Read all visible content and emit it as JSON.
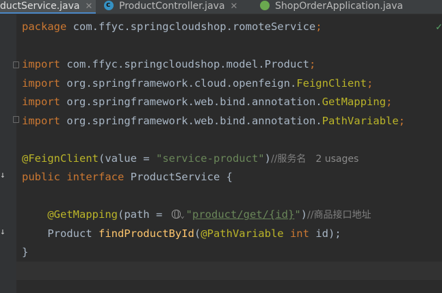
{
  "tabs": [
    {
      "label": "ductService.java",
      "close": "✕",
      "active": true
    },
    {
      "label": "ProductController.java",
      "close": "✕",
      "active": false
    },
    {
      "label": "ShopOrderApplication.java",
      "active": false
    }
  ],
  "code": {
    "l1_kw": "package",
    "l1_rest": " com.ffyc.springcloudshop.romoteService",
    "l1_semi": ";",
    "l3_kw": "import",
    "l3_rest": " com.ffyc.springcloudshop.model.Product",
    "l3_semi": ";",
    "l4_kw": "import",
    "l4_pkg": " org.springframework.cloud.openfeign.",
    "l4_cls": "FeignClient",
    "l4_semi": ";",
    "l5_kw": "import",
    "l5_pkg": " org.springframework.web.bind.annotation.",
    "l5_cls": "GetMapping",
    "l5_semi": ";",
    "l6_kw": "import",
    "l6_pkg": " org.springframework.web.bind.annotation.",
    "l6_cls": "PathVariable",
    "l6_semi": ";",
    "l8_ann": "@FeignClient",
    "l8_paren": "(value = ",
    "l8_str": "\"service-product\"",
    "l8_close": ")",
    "l8_cmt": "//服务名",
    "l8_usages": "2 usages",
    "l9_kw1": "public",
    "l9_kw2": "interface",
    "l9_name": " ProductService {",
    "l11_ann": "@GetMapping",
    "l11_paren": "(path = ",
    "l11_q1": "\"",
    "l11_link": "product/get/{id}",
    "l11_q2": "\"",
    "l11_close": ")",
    "l11_cmt": "//商品接口地址",
    "l12_type": "Product ",
    "l12_fn": "findProductById",
    "l12_open": "(",
    "l12_ann": "@PathVariable",
    "l12_kw": " int",
    "l12_rest": " id);",
    "l13": "}"
  },
  "gutter": {
    "impl_mark": "↓"
  },
  "status": {
    "check": "✓"
  },
  "colors": {
    "background": "#2b2b2b",
    "keyword": "#cc7832",
    "annotation": "#bbb529",
    "string": "#6a8759",
    "comment": "#808080",
    "method": "#ffc66d",
    "text": "#a9b7c6"
  },
  "icons": [
    "class-icon",
    "spring-boot-icon",
    "globe-icon",
    "chevron-down-icon",
    "implemented-arrow-icon",
    "check-icon"
  ]
}
